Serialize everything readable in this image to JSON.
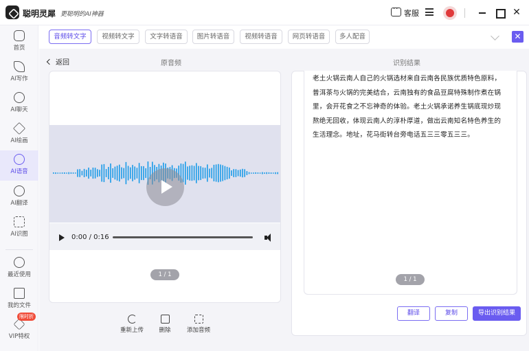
{
  "app": {
    "name": "聪明灵犀",
    "slogan": "更聪明的AI神器",
    "service_label": "客服"
  },
  "sidebar": {
    "items": [
      {
        "id": "home",
        "label": "首页"
      },
      {
        "id": "write",
        "label": "AI写作"
      },
      {
        "id": "chat",
        "label": "AI聊天"
      },
      {
        "id": "draw",
        "label": "AI绘画"
      },
      {
        "id": "voice",
        "label": "AI语音"
      },
      {
        "id": "translate",
        "label": "AI翻译"
      },
      {
        "id": "recognize",
        "label": "AI识图"
      },
      {
        "id": "recent",
        "label": "最近使用"
      },
      {
        "id": "files",
        "label": "我的文件"
      },
      {
        "id": "vip",
        "label": "VIP特权"
      }
    ],
    "vip_badge": "限时折"
  },
  "tabs": [
    {
      "label": "音频转文字",
      "active": true
    },
    {
      "label": "视频转文字",
      "active": false
    },
    {
      "label": "文字转语音",
      "active": false
    },
    {
      "label": "图片转语音",
      "active": false
    },
    {
      "label": "视频转语音",
      "active": false
    },
    {
      "label": "网页转语音",
      "active": false
    },
    {
      "label": "多人配音",
      "active": false
    }
  ],
  "main": {
    "back_label": "返回",
    "left_title": "原音频",
    "right_title": "识别结果"
  },
  "audio_player": {
    "current_time": "0:00",
    "duration": "0:16",
    "time_display": "0:00 / 0:16",
    "progress": 0
  },
  "left_pager": "1 / 1",
  "right_pager": "1 / 1",
  "actions": {
    "reupload": "重新上传",
    "delete": "删除",
    "add_audio": "添加音频"
  },
  "result": {
    "lines": [
      "老土火锅云南人自己的火锅选材来自云南各民族优质特色原料，",
      "普洱茶与火锅的完美结合，云南独有的食品豆腐特殊制作煮在锅",
      "里，会开花食之不忘神奇的体验。老土火锅承诺养生锅底现炒现",
      "熬绝无回收，体现云南人的淳朴厚道，做出云南知名特色养生的",
      "生活理念。地址，花马街转台旁电话五三三零五三三。"
    ]
  },
  "buttons": {
    "translate": "翻译",
    "copy": "复制",
    "export": "导出识别结果"
  },
  "colors": {
    "accent": "#6a5cf0",
    "wave": "#1a9be8",
    "badge": "#f04d3a"
  }
}
